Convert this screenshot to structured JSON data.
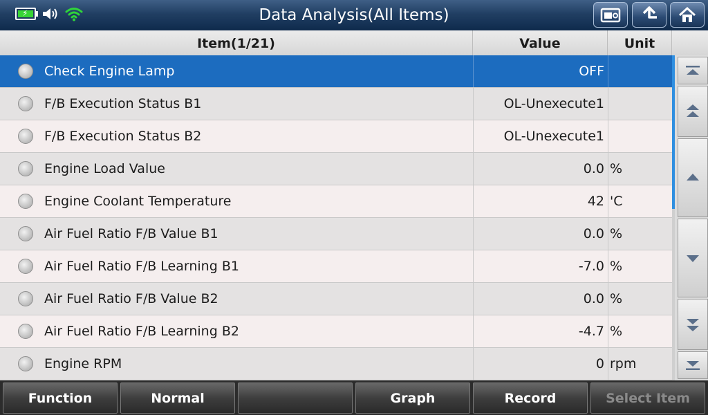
{
  "header": {
    "title": "Data Analysis(All Items)",
    "icons": [
      "battery-charging-icon",
      "speaker-icon",
      "wifi-icon"
    ],
    "buttons": [
      "screenshot-icon",
      "back-icon",
      "home-icon"
    ]
  },
  "table": {
    "columns": {
      "item": "Item(1/21)",
      "value": "Value",
      "unit": "Unit"
    },
    "rows": [
      {
        "name": "Check Engine Lamp",
        "value": "OFF",
        "unit": ""
      },
      {
        "name": "F/B Execution Status B1",
        "value": "OL-Unexecute1",
        "unit": ""
      },
      {
        "name": "F/B Execution Status B2",
        "value": "OL-Unexecute1",
        "unit": ""
      },
      {
        "name": "Engine Load Value",
        "value": "0.0",
        "unit": "%"
      },
      {
        "name": "Engine Coolant Temperature",
        "value": "42",
        "unit": "'C"
      },
      {
        "name": "Air Fuel Ratio F/B Value B1",
        "value": "0.0",
        "unit": "%"
      },
      {
        "name": "Air Fuel Ratio F/B Learning B1",
        "value": "-7.0",
        "unit": "%"
      },
      {
        "name": "Air Fuel Ratio F/B Value B2",
        "value": "0.0",
        "unit": "%"
      },
      {
        "name": "Air Fuel Ratio F/B Learning B2",
        "value": "-4.7",
        "unit": "%"
      },
      {
        "name": "Engine RPM",
        "value": "0",
        "unit": "rpm"
      }
    ]
  },
  "footer": {
    "buttons": [
      {
        "label": "Function",
        "enabled": true
      },
      {
        "label": "Normal",
        "enabled": true
      },
      {
        "label": "",
        "enabled": true
      },
      {
        "label": "Graph",
        "enabled": true
      },
      {
        "label": "Record",
        "enabled": true
      },
      {
        "label": "Select Item",
        "enabled": false
      }
    ]
  },
  "colors": {
    "selected_row": "#1c6cbf",
    "wifi": "#2fd53a",
    "scroll_thumb": "#2f8fe0"
  }
}
